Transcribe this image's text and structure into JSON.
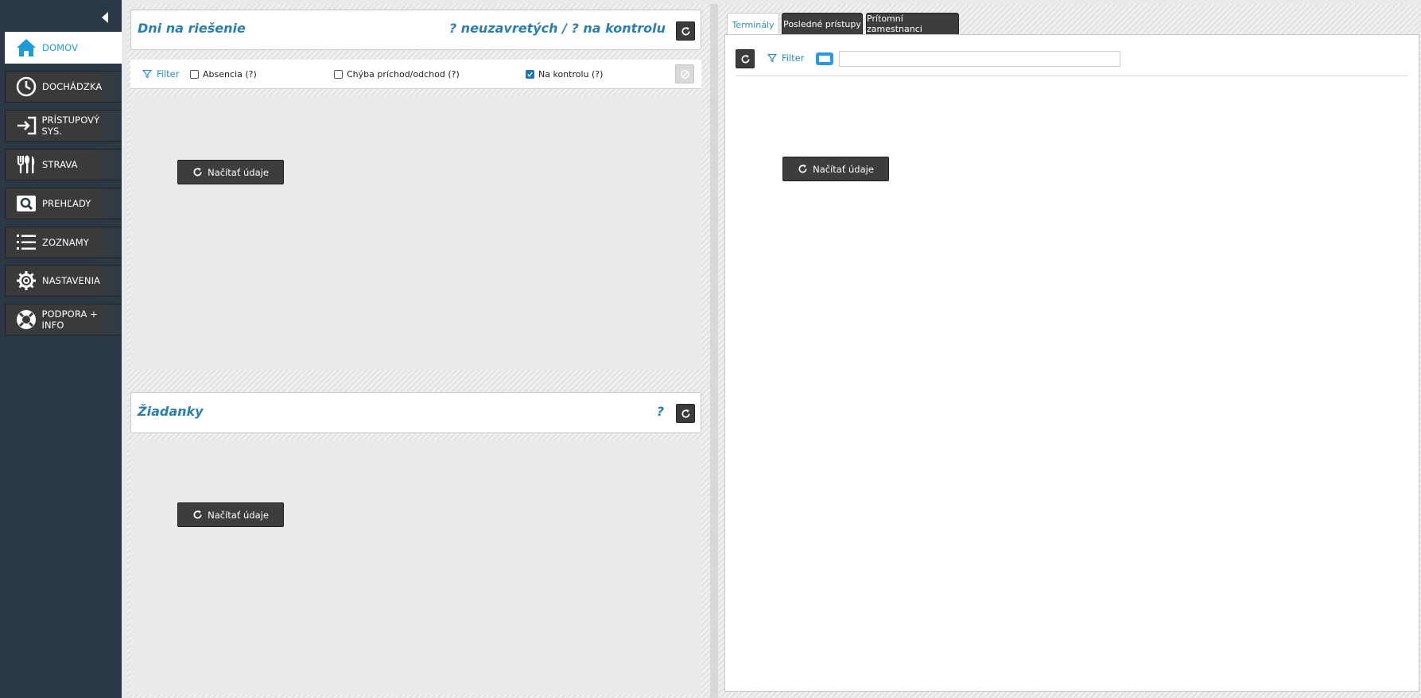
{
  "sidebar": {
    "items": [
      {
        "label": "DOMOV",
        "icon": "home-icon",
        "active": true
      },
      {
        "label": "DOCHÁDZKA",
        "icon": "clock-icon"
      },
      {
        "label": "PRÍSTUPOVÝ SYS.",
        "icon": "login-arrow-icon"
      },
      {
        "label": "STRAVA",
        "icon": "cutlery-icon"
      },
      {
        "label": "PREHĽADY",
        "icon": "search-icon"
      },
      {
        "label": "ZOZNAMY",
        "icon": "list-icon"
      },
      {
        "label": "NASTAVENIA",
        "icon": "gear-icon"
      },
      {
        "label": "PODPORA + INFO",
        "icon": "lifebuoy-icon"
      }
    ]
  },
  "days_panel": {
    "title": "Dni na riešenie",
    "counts": "? neuzavretých / ? na kontrolu",
    "filter_label": "Filter",
    "checkboxes": [
      {
        "label": "Absencia (?)",
        "checked": false
      },
      {
        "label": "Chýba príchod/odchod (?)",
        "checked": false
      },
      {
        "label": "Na kontrolu (?)",
        "checked": true
      }
    ],
    "load_label": "Načítať údaje"
  },
  "requests_panel": {
    "title": "Žiadanky",
    "count": "?",
    "load_label": "Načítať údaje"
  },
  "right": {
    "tabs": [
      {
        "label": "Terminály",
        "active": true
      },
      {
        "label": "Posledné prístupy"
      },
      {
        "label": "Prítomní zamestnanci"
      }
    ],
    "filter_label": "Filter",
    "filter_value": "",
    "load_label": "Načítať údaje"
  },
  "colors": {
    "accent": "#2a7fae",
    "sidebar": "#2b3846",
    "button": "#3d3d3d",
    "link": "#2a90c8"
  }
}
